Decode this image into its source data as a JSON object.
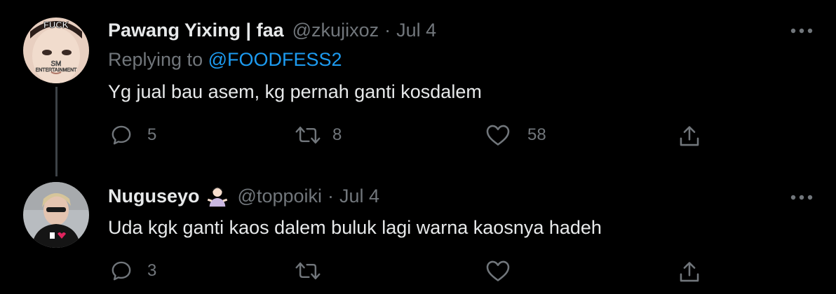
{
  "tweets": [
    {
      "name": "Pawang Yixing | faa",
      "handle": "@zkujixoz",
      "separator": "·",
      "date": "Jul 4",
      "replying_prefix": "Replying to ",
      "replying_to": "@FOODFESS2",
      "text": "Yg jual bau asem, kg pernah ganti kosdalem",
      "avatar_text_top": "FUCK",
      "avatar_text_bottom": "SM",
      "avatar_text_bottom2": "ENTERTAINMENT",
      "replies": "5",
      "retweets": "8",
      "likes": "58"
    },
    {
      "name": "Nuguseyo",
      "emoji": "person-shrugging-emoji",
      "handle": "@toppoiki",
      "separator": "·",
      "date": "Jul 4",
      "text": "Uda kgk ganti kaos dalem buluk lagi warna kaosnya hadeh",
      "replies": "3",
      "retweets": "",
      "likes": ""
    }
  ],
  "colors": {
    "background": "#000000",
    "primary_text": "#e7e9ea",
    "secondary_text": "#71767b",
    "mention": "#1d9bf0",
    "thread_line": "#3d4247"
  }
}
